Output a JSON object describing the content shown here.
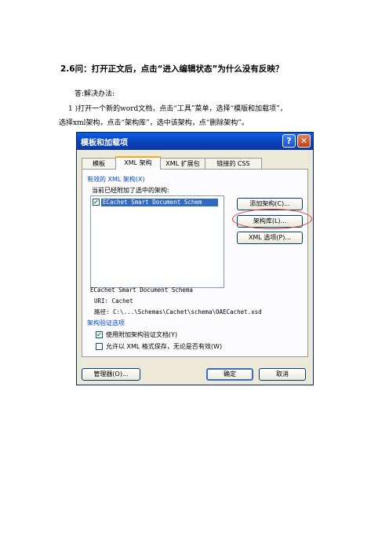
{
  "doc": {
    "question_title": "2.6问：打开正文后，点击“进入编辑状态”为什么没有反映？",
    "answer_label": "答:解决办法:",
    "step_line1": "1 )打开一个新的word文档，点击“工具”菜单，选择“模版和加载项”，",
    "step_line2": "选择xml架构，点击“架构库”，选中该架构，点“删除架构”。"
  },
  "dialog": {
    "title": "模板和加载项",
    "help_glyph": "?",
    "close_glyph": "✕",
    "tabs": [
      "模板",
      "XML 架构",
      "XML 扩展包",
      "链接的 CSS"
    ],
    "active_tab": 1,
    "group_label": "有效的 XML 架构(X)",
    "list_label": "当前已经附加了选中的架构:",
    "list_items": [
      {
        "checked": true,
        "label": "ECachet Smart Document Schem"
      }
    ],
    "buttons": {
      "add_schema": "添加架构(C)...",
      "schema_library": "架构库(L)...",
      "xml_options": "XML 选项(P)..."
    },
    "schema_name": "ECachet Smart Document Schema",
    "uri_label": "URI: Cachet",
    "path_label": "路径: C:\\...\\Schemas\\Cachet\\schema\\OAECachet.xsd",
    "validation_group": "架构验证选项",
    "options": [
      {
        "checked": true,
        "label": "使用附加架构验证文档(Y)"
      },
      {
        "checked": false,
        "label": "允许以 XML 格式保存，无论是否有效(W)"
      }
    ],
    "footer": {
      "organizer": "管理器(O)...",
      "ok": "确定",
      "cancel": "取消"
    },
    "check_glyph": "✔"
  }
}
